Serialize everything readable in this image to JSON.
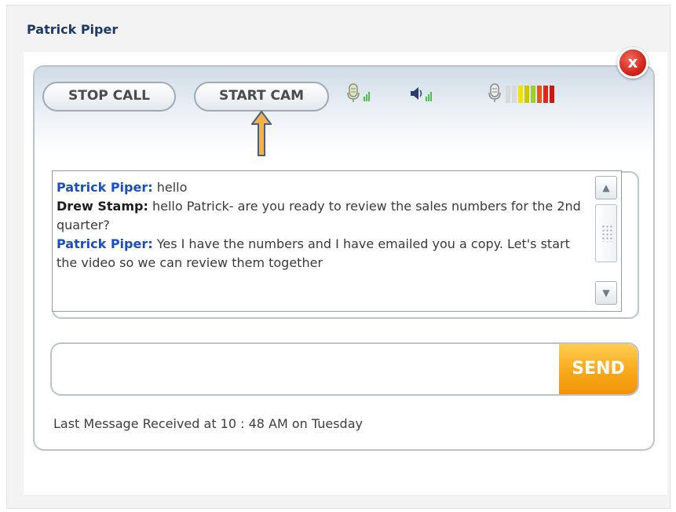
{
  "window": {
    "title": "Patrick Piper",
    "close_label": "x"
  },
  "toolbar": {
    "stop_call_label": "STOP CALL",
    "start_cam_label": "START CAM",
    "level_colors": [
      "#d9d9d9",
      "#d9d9d9",
      "#f2e200",
      "#c9c900",
      "#9fcf2a",
      "#e15a1c",
      "#d82a1c",
      "#c91a12"
    ]
  },
  "chat": {
    "messages": [
      {
        "speaker": "Patrick Piper:",
        "text": " hello"
      },
      {
        "speaker": "Drew Stamp:",
        "text": " hello Patrick- are you ready to review the sales numbers for the 2nd quarter?"
      },
      {
        "speaker": "Patrick Piper:",
        "text": " Yes I have the numbers and I have emailed you a copy.  Let's start the video so we can review them together"
      }
    ]
  },
  "composer": {
    "input_value": "",
    "send_label": "SEND"
  },
  "status": {
    "text": "Last Message Received at 10 : 48 AM on Tuesday"
  },
  "colors": {
    "speaker_self": "#1a4fc2",
    "speaker_other": "#1d1d1d",
    "send_button": "#f8a81b",
    "close_button": "#d3271b",
    "annotation_arrow": "#f4b24a"
  },
  "icons": {
    "mic": "microphone-icon",
    "speaker": "speaker-icon",
    "signal": "signal-bars-icon",
    "close": "close-icon",
    "annotation": "arrow-up-icon"
  }
}
